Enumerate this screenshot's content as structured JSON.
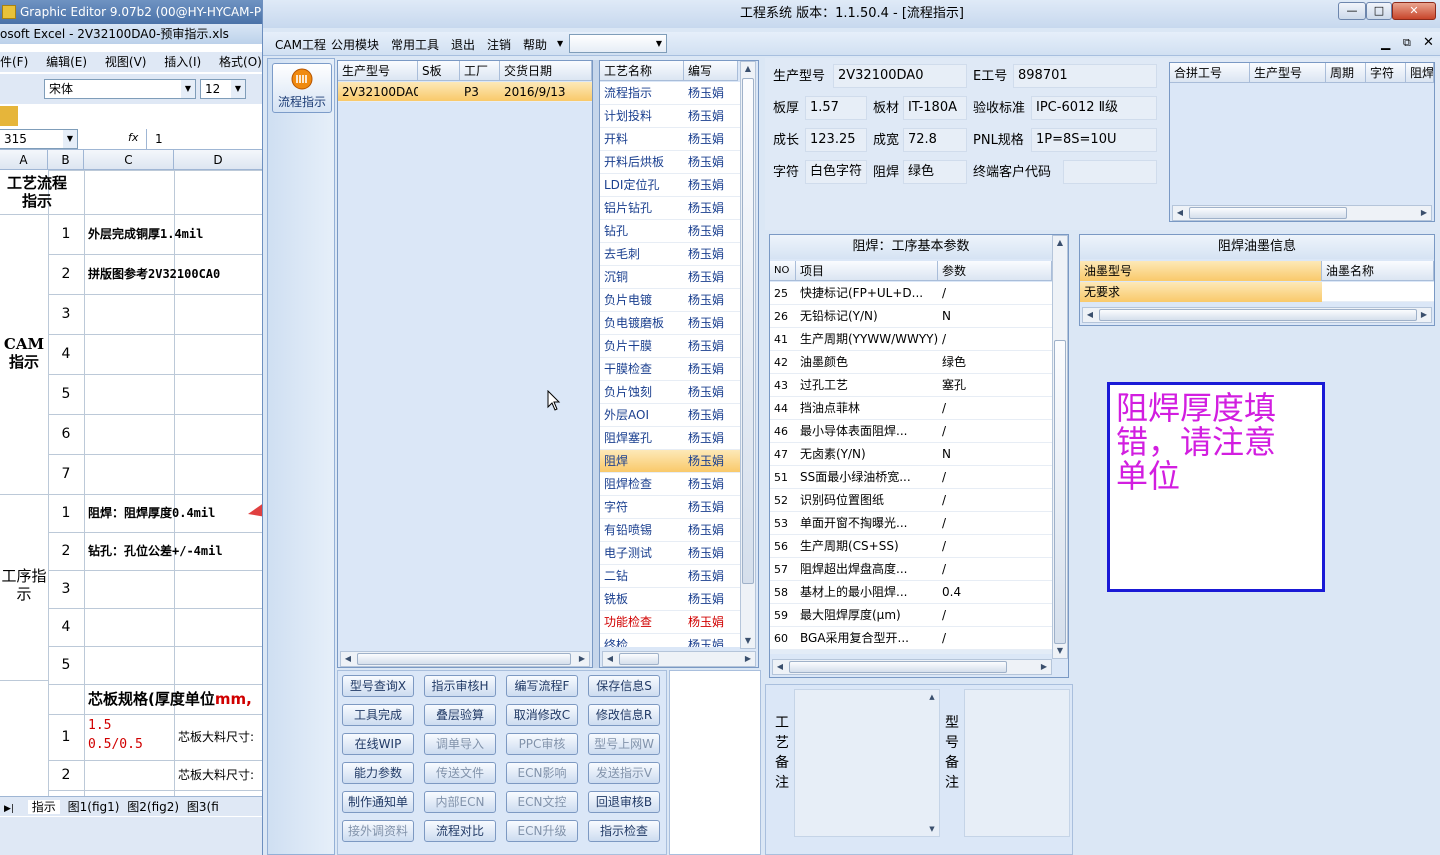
{
  "excel": {
    "title": "Graphic Editor 9.07b2 (00@HY-HYCAM-P",
    "subtitle": "osoft Excel - 2V32100DA0-预审指示.xls",
    "menu": [
      "件(F)",
      "编辑(E)",
      "视图(V)",
      "插入(I)",
      "格式(O)"
    ],
    "font_name": "宋体",
    "font_size": "12",
    "name_box": "315",
    "fx": "fx",
    "formula_value": "1",
    "columns": [
      "A",
      "B",
      "C",
      "D"
    ],
    "section1_title": "工艺流程指示",
    "cam_label": "CAM指示",
    "cam_rows": [
      {
        "no": "1",
        "text": "外层完成铜厚1.4mil"
      },
      {
        "no": "2",
        "text": "拼版图参考2V32100CA0"
      },
      {
        "no": "3",
        "text": ""
      },
      {
        "no": "4",
        "text": ""
      },
      {
        "no": "5",
        "text": ""
      },
      {
        "no": "6",
        "text": ""
      },
      {
        "no": "7",
        "text": ""
      }
    ],
    "proc_label": "工序指示",
    "proc_rows": [
      {
        "no": "1",
        "text": "阻焊：阻焊厚度0.4mil"
      },
      {
        "no": "2",
        "text": "钻孔：孔位公差+/-4mil"
      },
      {
        "no": "3",
        "text": ""
      },
      {
        "no": "4",
        "text": ""
      },
      {
        "no": "5",
        "text": ""
      }
    ],
    "core_title": "芯板规格(厚度单位",
    "core_unit": "mm,",
    "core_rows": [
      {
        "no": "1",
        "thick1": "1.5",
        "thick2": "0.5/0.5",
        "label": "芯板大料尺寸:"
      },
      {
        "no": "2",
        "thick1": "",
        "thick2": "",
        "label": "芯板大料尺寸:"
      }
    ],
    "sheet_tabs": [
      "指示",
      "图1(fig1)",
      "图2(fig2)",
      "图3(fi"
    ]
  },
  "main": {
    "title": "工程系统   版本：1.1.50.4 - [流程指示]",
    "menu": [
      "CAM工程",
      "公用模块",
      "常用工具",
      "退出",
      "注销",
      "帮助"
    ],
    "nav_button": "流程指示",
    "orders": {
      "headers": [
        "生产型号",
        "S板",
        "工厂",
        "交货日期"
      ],
      "rows": [
        {
          "model": "2V32100DA0",
          "s": "",
          "factory": "P3",
          "date": "2016/9/13"
        }
      ]
    },
    "process": {
      "headers": [
        "工艺名称",
        "编写"
      ],
      "selected_index": 16,
      "red_index": 23,
      "rows": [
        {
          "name": "流程指示",
          "writer": "杨玉娟"
        },
        {
          "name": "计划投料",
          "writer": "杨玉娟"
        },
        {
          "name": "开料",
          "writer": "杨玉娟"
        },
        {
          "name": "开料后烘板",
          "writer": "杨玉娟"
        },
        {
          "name": "LDI定位孔",
          "writer": "杨玉娟"
        },
        {
          "name": "铝片钻孔",
          "writer": "杨玉娟"
        },
        {
          "name": "钻孔",
          "writer": "杨玉娟"
        },
        {
          "name": "去毛刺",
          "writer": "杨玉娟"
        },
        {
          "name": "沉铜",
          "writer": "杨玉娟"
        },
        {
          "name": "负片电镀",
          "writer": "杨玉娟"
        },
        {
          "name": "负电镀磨板",
          "writer": "杨玉娟"
        },
        {
          "name": "负片干膜",
          "writer": "杨玉娟"
        },
        {
          "name": "干膜检查",
          "writer": "杨玉娟"
        },
        {
          "name": "负片蚀刻",
          "writer": "杨玉娟"
        },
        {
          "name": "外层AOI",
          "writer": "杨玉娟"
        },
        {
          "name": "阻焊塞孔",
          "writer": "杨玉娟"
        },
        {
          "name": "阻焊",
          "writer": "杨玉娟"
        },
        {
          "name": "阻焊检查",
          "writer": "杨玉娟"
        },
        {
          "name": "字符",
          "writer": "杨玉娟"
        },
        {
          "name": "有铅喷锡",
          "writer": "杨玉娟"
        },
        {
          "name": "电子测试",
          "writer": "杨玉娟"
        },
        {
          "name": "二钻",
          "writer": "杨玉娟"
        },
        {
          "name": "铣板",
          "writer": "杨玉娟"
        },
        {
          "name": "功能检查",
          "writer": "杨玉娟"
        },
        {
          "name": "终检",
          "writer": "杨玉娟"
        }
      ]
    },
    "buttons": [
      [
        "型号查询X",
        "指示审核H",
        "编写流程F",
        "保存信息S"
      ],
      [
        "工具完成",
        "叠层验算",
        "取消修改C",
        "修改信息R"
      ],
      [
        "在线WIP",
        "调单导入",
        "PPC审核",
        "型号上网W"
      ],
      [
        "能力参数",
        "传送文件",
        "ECN影响",
        "发送指示V"
      ],
      [
        "制作通知单",
        "内部ECN",
        "ECN文控",
        "回退审核B"
      ],
      [
        "接外调资料",
        "流程对比",
        "ECN升级",
        "指示检查"
      ]
    ],
    "disabled_buttons": [
      "调单导入",
      "PPC审核",
      "型号上网W",
      "传送文件",
      "ECN影响",
      "发送指示V",
      "内部ECN",
      "ECN文控",
      "接外调资料",
      "ECN升级"
    ],
    "info": {
      "model_label": "生产型号",
      "model": "2V32100DA0",
      "e_label": "E工号",
      "e_no": "898701",
      "thick_label": "板厚",
      "thick": "1.57",
      "mat_label": "板材",
      "mat": "IT-180A",
      "std_label": "验收标准",
      "std": "IPC-6012 Ⅱ级",
      "len_label": "成长",
      "len": "123.25",
      "wid_label": "成宽",
      "wid": "72.8",
      "pnl_label": "PNL规格",
      "pnl": "1P=8S=10U",
      "char_label": "字符",
      "char": "白色字符",
      "sm_label": "阻焊",
      "sm": "绿色",
      "cust_label": "终端客户代码",
      "cust": ""
    },
    "merge_headers": [
      "合拼工号",
      "生产型号",
      "周期",
      "字符",
      "阻焊"
    ],
    "params": {
      "title": "阻焊：工序基本参数",
      "headers": [
        "NO",
        "项目",
        "参数"
      ],
      "rows": [
        {
          "no": "25",
          "item": "快捷标记(FP+UL+D...",
          "val": "/"
        },
        {
          "no": "26",
          "item": "无铅标记(Y/N)",
          "val": "N"
        },
        {
          "no": "41",
          "item": "生产周期(YYWW/WWYY)",
          "val": "/"
        },
        {
          "no": "42",
          "item": "油墨颜色",
          "val": "绿色"
        },
        {
          "no": "43",
          "item": "过孔工艺",
          "val": "塞孔"
        },
        {
          "no": "44",
          "item": "挡油点菲林",
          "val": "/"
        },
        {
          "no": "46",
          "item": "最小导体表面阻焊...",
          "val": "/"
        },
        {
          "no": "47",
          "item": "无卤素(Y/N)",
          "val": "N"
        },
        {
          "no": "51",
          "item": "SS面最小绿油桥宽...",
          "val": "/"
        },
        {
          "no": "52",
          "item": "识别码位置图纸",
          "val": "/"
        },
        {
          "no": "53",
          "item": "单面开窗不掏曝光...",
          "val": "/"
        },
        {
          "no": "56",
          "item": "生产周期(CS+SS)",
          "val": "/"
        },
        {
          "no": "57",
          "item": "阻焊超出焊盘高度...",
          "val": "/"
        },
        {
          "no": "58",
          "item": "基材上的最小阻焊...",
          "val": "0.4"
        },
        {
          "no": "59",
          "item": "最大阻焊厚度(μm)",
          "val": "/"
        },
        {
          "no": "60",
          "item": "BGA采用复合型开...",
          "val": "/"
        }
      ]
    },
    "ink": {
      "title": "阻焊油墨信息",
      "headers": [
        "油墨型号",
        "油墨名称"
      ],
      "rows": [
        {
          "model": "无要求",
          "name": ""
        }
      ]
    },
    "annotation": "阻焊厚度填错，请注意单位",
    "remarks": {
      "process_label": "工艺备注",
      "model_label": "型号备注"
    }
  },
  "colors": {
    "accent_orange": "#f9c96a",
    "annotation_purple": "#d21ee0",
    "annotation_border": "#1a1ad6",
    "arrow_red": "#e04040"
  }
}
